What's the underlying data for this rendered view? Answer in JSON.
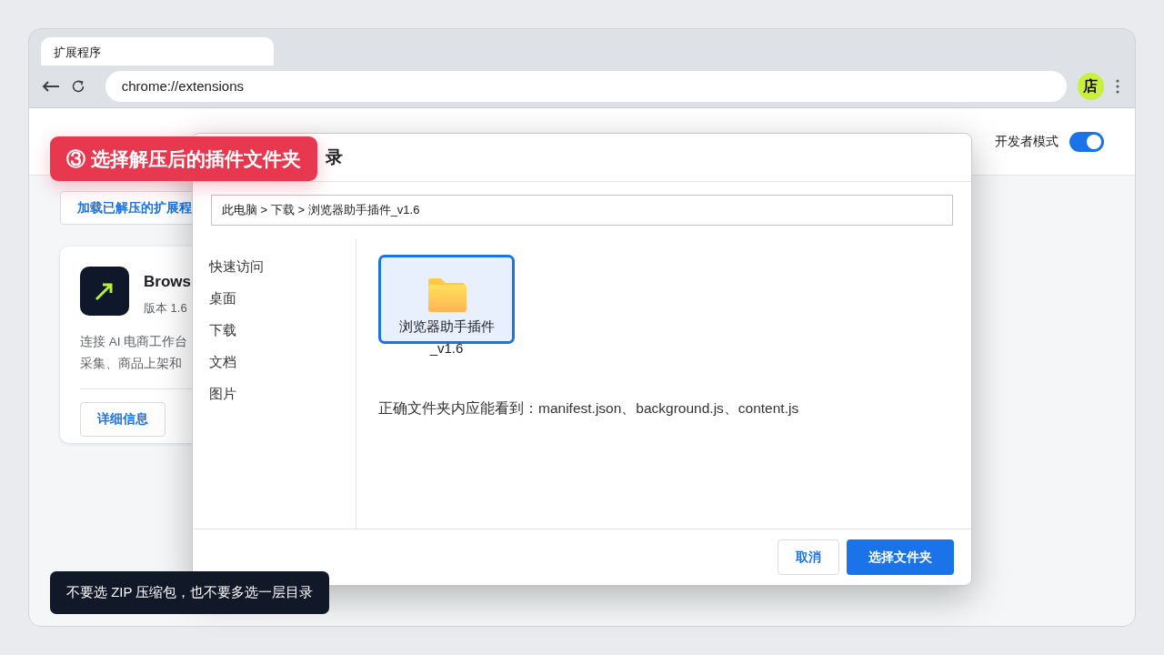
{
  "browser": {
    "tab_title": "扩展程序",
    "url": "chrome://extensions",
    "profile_label": "店"
  },
  "page": {
    "developer_mode": {
      "label": "开发者模式",
      "on": true
    },
    "load_button": "加载已解压的扩展程",
    "extension": {
      "name": "Brows",
      "version": "版本 1.6",
      "description_lines": [
        "连接 AI 电商工作台",
        "采集、商品上架和"
      ],
      "details_button": "详细信息"
    }
  },
  "dialog": {
    "title": "录",
    "path": "此电脑 > 下载 > 浏览器助手插件_v1.6",
    "sidebar": [
      "快速访问",
      "桌面",
      "下载",
      "文档",
      "图片"
    ],
    "items": [
      {
        "name": "浏览器助手插件_v1.6",
        "selected": true
      }
    ],
    "hint": "正确文件夹内应能看到：manifest.json、background.js、content.js",
    "buttons": [
      {
        "label": "取消",
        "kind": "secondary"
      },
      {
        "label": "选择文件夹",
        "kind": "primary"
      }
    ]
  },
  "callout": "③ 选择解压后的插件文件夹",
  "tooltip": "不要选 ZIP 压缩包，也不要多选一层目录"
}
